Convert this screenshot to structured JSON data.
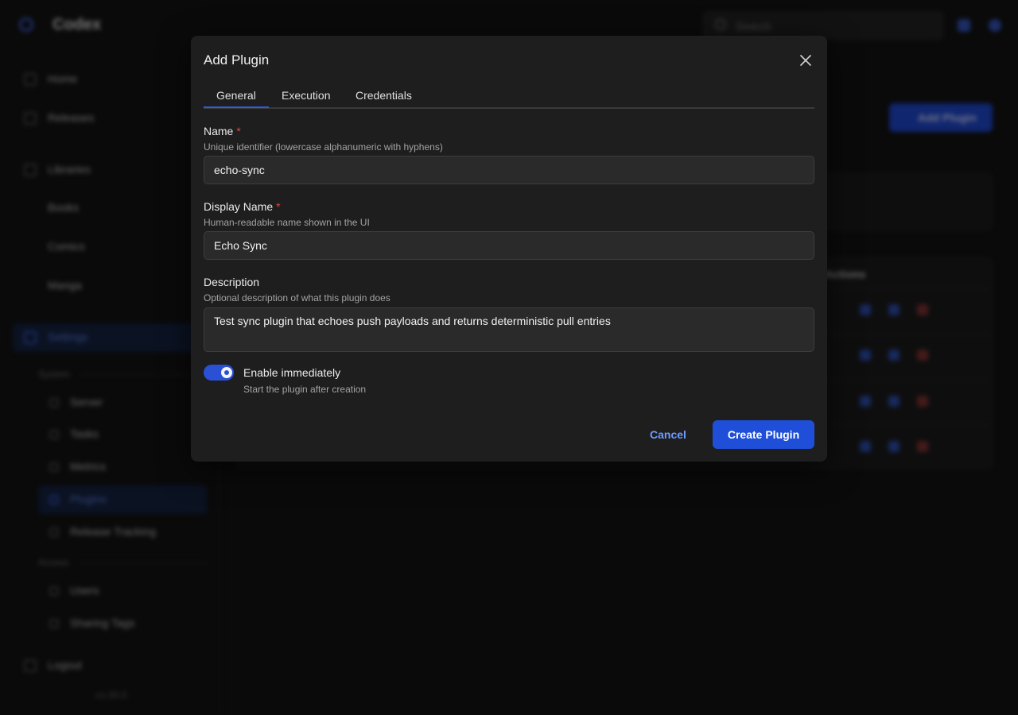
{
  "app": {
    "title": "Codex",
    "search_placeholder": "Search"
  },
  "sidebar": {
    "items": [
      {
        "label": "Home",
        "icon": "home-icon"
      },
      {
        "label": "Releases",
        "icon": "box-icon"
      },
      {
        "label": "Libraries",
        "icon": "library-icon"
      },
      {
        "label": "Books"
      },
      {
        "label": "Comics"
      },
      {
        "label": "Manga"
      },
      {
        "label": "Settings",
        "icon": "gear-icon"
      }
    ],
    "system_label": "System",
    "system_items": [
      "Server",
      "Tasks",
      "Metrics",
      "Plugins",
      "Release Tracking"
    ],
    "access_label": "Access",
    "access_items": [
      "Users",
      "Sharing Tags"
    ],
    "logout": "Logout",
    "version": "v1.00.0"
  },
  "main": {
    "add_plugin_button": "Add Plugin",
    "table_column": "Actions"
  },
  "colors": {
    "accent": "#1f4fd8",
    "required": "#e0443e",
    "link": "#6f9cff"
  },
  "dialog": {
    "title": "Add Plugin",
    "tabs": [
      {
        "label": "General",
        "active": true
      },
      {
        "label": "Execution",
        "active": false
      },
      {
        "label": "Credentials",
        "active": false
      }
    ],
    "fields": {
      "name": {
        "label": "Name",
        "required_mark": "*",
        "help": "Unique identifier (lowercase alphanumeric with hyphens)",
        "value": "echo-sync"
      },
      "display_name": {
        "label": "Display Name",
        "required_mark": "*",
        "help": "Human-readable name shown in the UI",
        "value": "Echo Sync"
      },
      "description": {
        "label": "Description",
        "help": "Optional description of what this plugin does",
        "value": "Test sync plugin that echoes push payloads and returns deterministic pull entries"
      }
    },
    "toggle": {
      "label": "Enable immediately",
      "help": "Start the plugin after creation",
      "on": true
    },
    "cancel_label": "Cancel",
    "create_label": "Create Plugin"
  }
}
